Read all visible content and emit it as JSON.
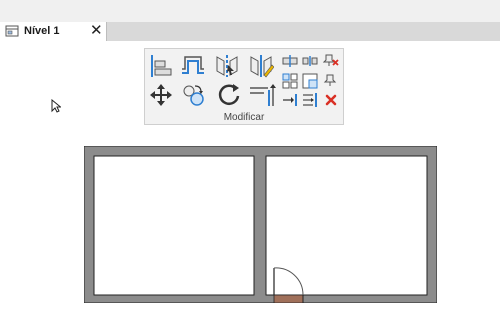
{
  "tab": {
    "label": "Nível 1",
    "close_glyph": "✕"
  },
  "ribbon": {
    "panel_label": "Modificar",
    "tools": [
      "align-icon",
      "offset-icon",
      "mirror-pick-axis-icon",
      "mirror-draw-axis-icon",
      "split-element-icon",
      "split-with-gap-icon",
      "unpin-icon",
      "move-icon",
      "copy-icon",
      "rotate-icon",
      "trim-extend-corner-icon",
      "array-icon",
      "scale-icon",
      "pin-icon",
      "trim-extend-single-icon",
      "trim-extend-multiple-icon",
      "delete-icon"
    ]
  },
  "colors": {
    "wall": "#8c8c8c",
    "door_swing": "#555555",
    "door_sill": "#a0705a",
    "accent_blue": "#2f7fd1",
    "delete_red": "#d93025"
  }
}
